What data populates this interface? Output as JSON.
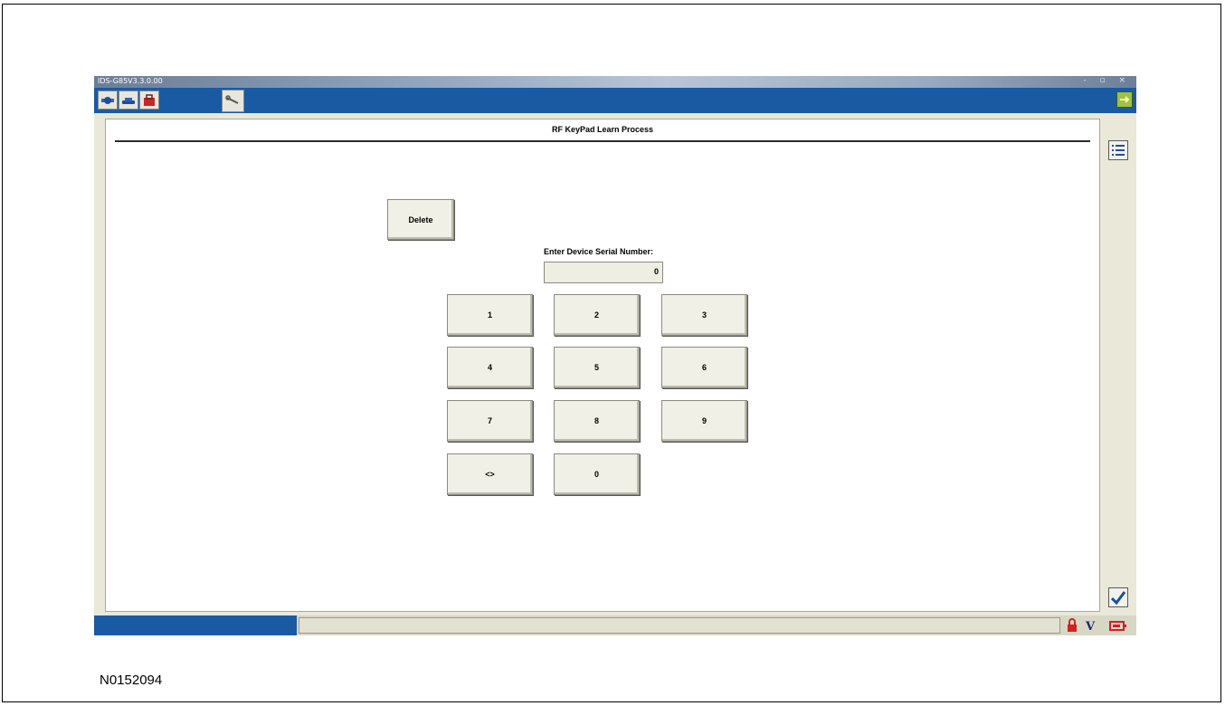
{
  "window": {
    "title": "IDS-G85V3.3.0.00",
    "title_controls": "- ▫ ×"
  },
  "toolbar": {
    "icons": [
      "network-icon",
      "vehicle-icon",
      "toolbox-icon",
      "wrench-icon"
    ],
    "exit_icon": "exit-arrow-icon"
  },
  "page": {
    "title": "RF KeyPad Learn Process",
    "delete_label": "Delete",
    "serial_label": "Enter Device Serial Number:",
    "serial_value": "0"
  },
  "keypad": {
    "keys": [
      "1",
      "2",
      "3",
      "4",
      "5",
      "6",
      "7",
      "8",
      "9",
      "<>",
      "0"
    ]
  },
  "side": {
    "list_icon": "list-icon",
    "confirm_icon": "checkmark-icon"
  },
  "status": {
    "icons": [
      "lock-icon",
      "vbat-icon",
      "battery-icon"
    ],
    "vbat_label": "V"
  },
  "figure_id": "N0152094"
}
